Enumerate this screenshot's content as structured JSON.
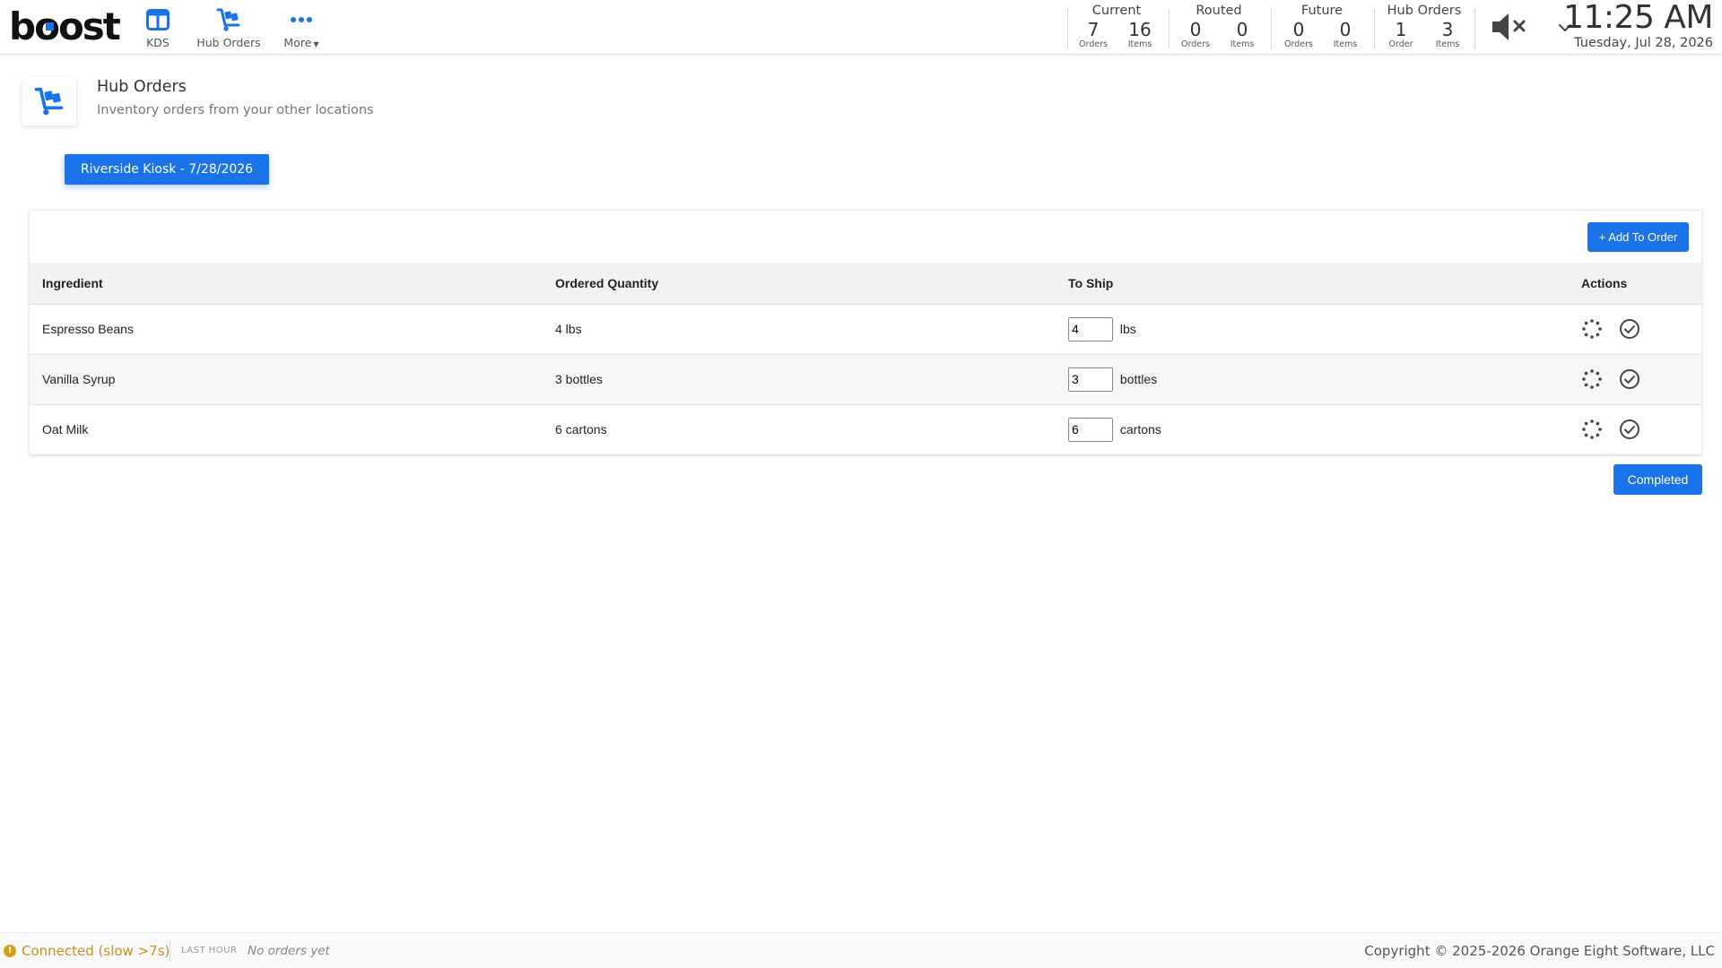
{
  "brand": {
    "logo_text": "boost",
    "accent_color": "#1a73e8"
  },
  "nav": {
    "kds": {
      "label": "KDS",
      "icon": "kds-layout-icon"
    },
    "hub_orders": {
      "label": "Hub Orders",
      "icon": "dolly-cart-icon"
    },
    "more": {
      "label": "More",
      "icon": "more-dots-icon"
    }
  },
  "stats": {
    "current": {
      "title": "Current",
      "orders": "7",
      "orders_unit": "Orders",
      "items": "16",
      "items_unit": "Items"
    },
    "routed": {
      "title": "Routed",
      "orders": "0",
      "orders_unit": "Orders",
      "items": "0",
      "items_unit": "Items"
    },
    "future": {
      "title": "Future",
      "orders": "0",
      "orders_unit": "Orders",
      "items": "0",
      "items_unit": "Items"
    },
    "hub_orders": {
      "title": "Hub Orders",
      "orders": "1",
      "orders_unit": "Order",
      "items": "3",
      "items_unit": "Items"
    }
  },
  "sound": {
    "icon": "volume-muted-icon"
  },
  "clock": {
    "time": "11:25 AM",
    "date": "Tuesday, Jul 28, 2026"
  },
  "page": {
    "title": "Hub Orders",
    "subtitle": "Inventory orders from your other locations",
    "icon": "dolly-cart-icon"
  },
  "location_button": "Riverside Kiosk - 7/28/2026",
  "table": {
    "add_button": "+ Add To Order",
    "headers": {
      "ingredient": "Ingredient",
      "ordered": "Ordered Quantity",
      "to_ship": "To Ship",
      "actions": "Actions"
    },
    "rows": [
      {
        "ingredient": "Espresso Beans",
        "ordered": "4 lbs",
        "ship_value": "4",
        "ship_unit": "lbs"
      },
      {
        "ingredient": "Vanilla Syrup",
        "ordered": "3 bottles",
        "ship_value": "3",
        "ship_unit": "bottles"
      },
      {
        "ingredient": "Oat Milk",
        "ordered": "6 cartons",
        "ship_value": "6",
        "ship_unit": "cartons"
      }
    ]
  },
  "completed_button": "Completed",
  "footer": {
    "connection_icon": "!",
    "connection_status": "Connected (slow >7s)",
    "connection_color": "#c8901a",
    "last_hour_label": "LAST HOUR",
    "last_hour_value": "No orders yet",
    "copyright": "Copyright © 2025-2026 Orange Eight Software, LLC"
  }
}
